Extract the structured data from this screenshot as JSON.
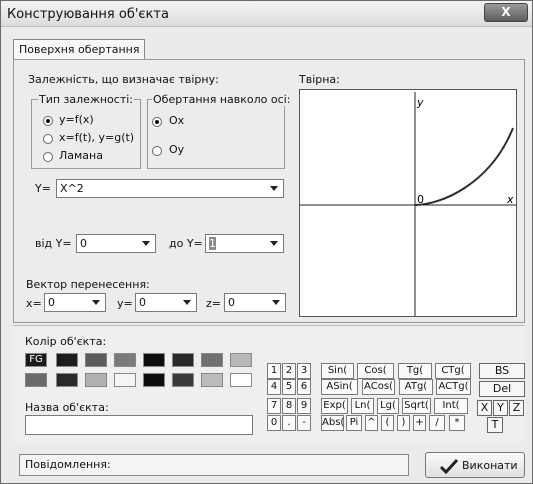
{
  "window": {
    "title": "Конструювання об'єкта",
    "close_label": "X"
  },
  "tab": {
    "label": "Поверхня обертання"
  },
  "dependency": {
    "heading": "Залежність, що визначає твірну:",
    "type_group": {
      "legend": "Тип залежності:",
      "options": [
        "y=f(x)",
        "x=f(t), y=g(t)",
        "Ламана"
      ],
      "selected": 0
    },
    "axis_group": {
      "legend": "Обертання навколо осі:",
      "options": [
        "Ox",
        "Oy"
      ],
      "selected": 0
    },
    "y_label": "Y=",
    "y_value": "X^2",
    "from_label": "від Y=",
    "from_value": "0",
    "to_label": "до Y=",
    "to_value": "1"
  },
  "generatrix": {
    "heading": "Твірна:",
    "axis_y": "y",
    "axis_x": "x",
    "origin": "0"
  },
  "translation": {
    "heading": "Вектор перенесення:",
    "x_label": "x=",
    "x_value": "0",
    "y_label": "y=",
    "y_value": "0",
    "z_label": "z=",
    "z_value": "0"
  },
  "color": {
    "heading": "Колір об'єкта:",
    "fg_label": "FG",
    "swatches_row1": [
      "#1a1a1a",
      "#1c1c1c",
      "#5a5a5a",
      "#7a7a7a",
      "#0d0d0d",
      "#2a2a2a",
      "#707070",
      "#b8b8b8"
    ],
    "swatches_row2": [
      "#6a6a6a",
      "#2a2a2a",
      "#b0b0b0",
      "#f4f4f4",
      "#0d0d0d",
      "#3a3a3a",
      "#bcbcbc",
      "#ffffff"
    ]
  },
  "name": {
    "heading": "Назва об'єкта:",
    "value": ""
  },
  "keypad": {
    "digits": [
      [
        "1",
        "2",
        "3"
      ],
      [
        "4",
        "5",
        "6"
      ],
      [
        "7",
        "8",
        "9"
      ],
      [
        "0",
        ".",
        "-"
      ]
    ],
    "functions": [
      [
        "Sin(",
        "Cos(",
        "Tg(",
        "CTg("
      ],
      [
        "ASin(",
        "ACos(",
        "ATg(",
        "ACTg("
      ],
      [
        "Exp(",
        "Ln(",
        "Lg(",
        "Sqrt(",
        "Int("
      ],
      [
        "Abs(",
        "Pi",
        "^",
        "(",
        ")",
        "+",
        "/",
        "*"
      ]
    ],
    "bs": "BS",
    "del": "Del",
    "vars": [
      "X",
      "Y",
      "Z"
    ],
    "t": "T"
  },
  "status": {
    "label": "Повідомлення:"
  },
  "execute": {
    "label": "Виконати"
  }
}
